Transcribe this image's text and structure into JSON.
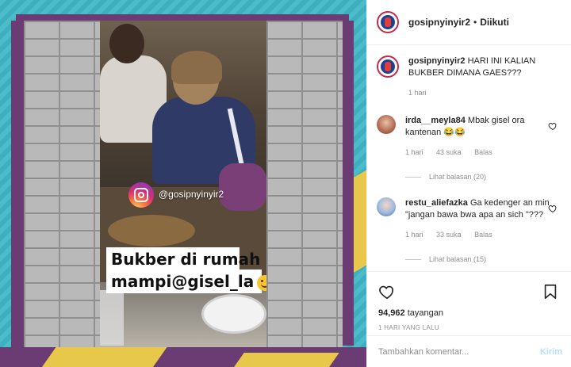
{
  "media": {
    "ig_handle": "@gosipnyinyir2",
    "sticker_line1": "Bukber di rumah",
    "sticker_line2": "mampi@gisel_la",
    "sticker_emoji": "smiling-face-emoji"
  },
  "header": {
    "username": "gosipnyinyir2",
    "separator": "•",
    "follow_status": "Diikuti"
  },
  "caption": {
    "username": "gosipnyinyir2",
    "text": "HARI INI KALIAN BUKBER DIMANA GAES???",
    "time": "1 hari"
  },
  "comments": [
    {
      "username": "irda__meyla84",
      "text": "Mbak gisel ora kantenan 😂😂",
      "time": "1 hari",
      "likes": "43 suka",
      "reply_label": "Balas",
      "view_replies": "Lihat balasan (20)"
    },
    {
      "username": "restu_aliefazka",
      "text": "Ga kedenger an min \"jangan bawa bwa apa an sich \"???",
      "time": "1 hari",
      "likes": "33 suka",
      "reply_label": "Balas",
      "view_replies": "Lihat balasan (15)"
    }
  ],
  "actions": {
    "views_count": "94,962",
    "views_label": "tayangan",
    "time_ago": "1 HARI YANG LALU"
  },
  "add_comment": {
    "placeholder": "Tambahkan komentar...",
    "post_label": "Kirim"
  },
  "colors": {
    "accent_link": "#b2dffc",
    "frame_teal": "#3fb6c6",
    "frame_purple": "#6b3b73",
    "frame_yellow": "#e8c84a"
  }
}
